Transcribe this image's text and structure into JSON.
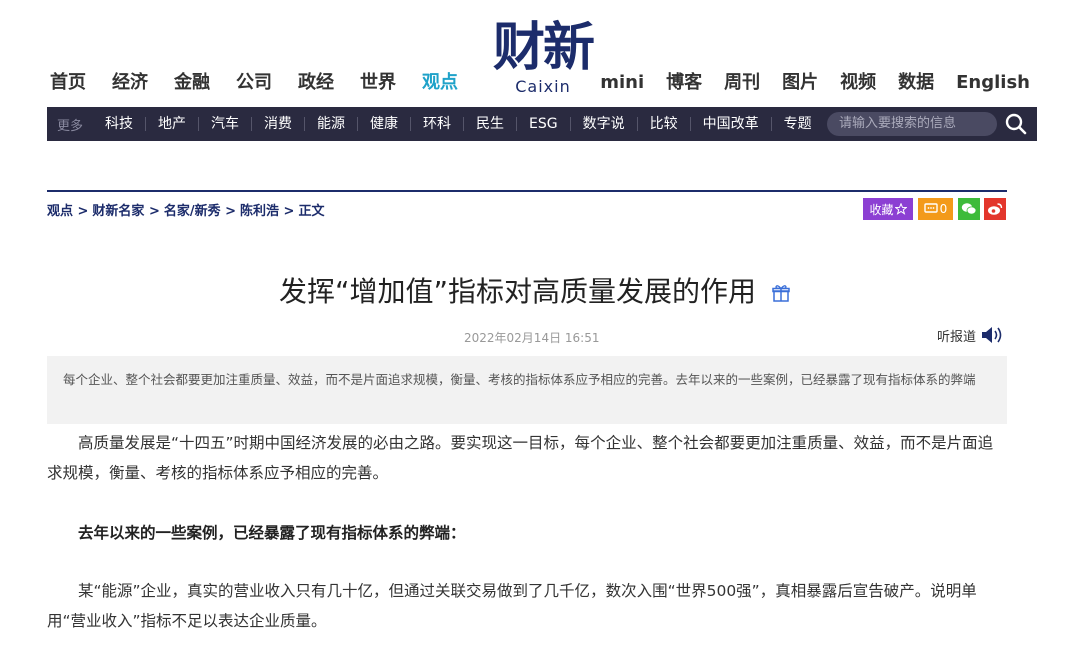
{
  "nav": {
    "left": [
      "首页",
      "经济",
      "金融",
      "公司",
      "政经",
      "世界",
      "观点"
    ],
    "active": "观点",
    "right": [
      "mini",
      "博客",
      "周刊",
      "图片",
      "视频",
      "数据",
      "English"
    ]
  },
  "logo": {
    "cn": "财新",
    "en": "Caixin"
  },
  "categories": {
    "more": "更多",
    "items": [
      "科技",
      "地产",
      "汽车",
      "消费",
      "能源",
      "健康",
      "环科",
      "民生",
      "ESG",
      "数字说",
      "比较",
      "中国改革",
      "专题"
    ]
  },
  "search": {
    "placeholder": "请输入要搜索的信息"
  },
  "breadcrumb": [
    "观点 >",
    "财新名家 >",
    "名家/新秀 >",
    "陈利浩 >",
    "正文"
  ],
  "share": {
    "collect": "收藏",
    "comment_count": "0"
  },
  "article": {
    "title": "发挥“增加值”指标对高质量发展的作用",
    "date": "2022年02月14日 16:51",
    "listen": "听报道",
    "summary": "每个企业、整个社会都要更加注重质量、效益，而不是片面追求规模，衡量、考核的指标体系应予相应的完善。去年以来的一些案例，已经暴露了现有指标体系的弊端",
    "p1": "高质量发展是“十四五”时期中国经济发展的必由之路。要实现这一目标，每个企业、整个社会都要更加注重质量、效益，而不是片面追求规模，衡量、考核的指标体系应予相应的完善。",
    "p2": "去年以来的一些案例，已经暴露了现有指标体系的弊端：",
    "p3": "某“能源”企业，真实的营业收入只有几十亿，但通过关联交易做到了几千亿，数次入围“世界500强”，真相暴露后宣告破产。说明单用“营业收入”指标不足以表达企业质量。"
  },
  "colors": {
    "brand": "#1c2c6b",
    "active_nav": "#1fa2c9",
    "catbar_bg": "#2a2a40"
  }
}
